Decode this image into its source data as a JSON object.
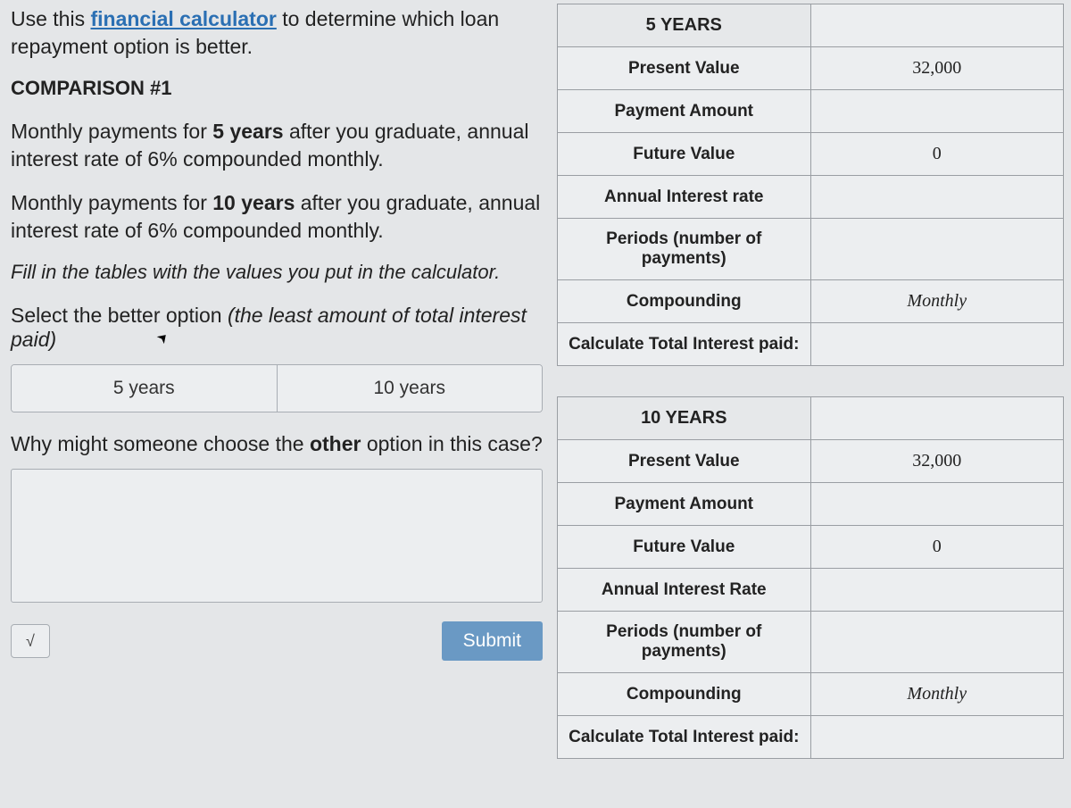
{
  "intro": {
    "prefix": "Use this ",
    "link": "financial calculator",
    "suffix": " to determine which loan repayment option is better."
  },
  "comparison_title": "COMPARISON #1",
  "para1": {
    "p1": "Monthly payments for ",
    "b": "5 years",
    "p2": " after you graduate, annual interest rate of 6% compounded monthly."
  },
  "para2": {
    "p1": "Monthly payments for ",
    "b": "10 years",
    "p2": " after you graduate, annual interest rate of 6% compounded monthly."
  },
  "fill_instruction": "Fill in the tables with the values you put in the calculator.",
  "select_prompt": {
    "a": "Select the better option ",
    "b": "(the least amount of total interest paid)"
  },
  "options": {
    "opt1": "5 years",
    "opt2": "10 years"
  },
  "why_prompt": {
    "a": "Why might someone choose the ",
    "b": "other",
    "c": " option in this case?"
  },
  "math_icon": "√",
  "submit_label": "Submit",
  "table5": {
    "title": "5 YEARS",
    "rows": [
      {
        "label": "Present Value",
        "value": "32,000"
      },
      {
        "label": "Payment Amount",
        "value": ""
      },
      {
        "label": "Future Value",
        "value": "0"
      },
      {
        "label": "Annual Interest rate",
        "value": ""
      },
      {
        "label": "Periods (number of payments)",
        "value": ""
      },
      {
        "label": "Compounding",
        "value": "Monthly",
        "italic": true
      },
      {
        "label": "Calculate Total Interest paid:",
        "value": ""
      }
    ]
  },
  "table10": {
    "title": "10 YEARS",
    "rows": [
      {
        "label": "Present Value",
        "value": "32,000"
      },
      {
        "label": "Payment Amount",
        "value": ""
      },
      {
        "label": "Future Value",
        "value": "0"
      },
      {
        "label": "Annual Interest Rate",
        "value": ""
      },
      {
        "label": "Periods (number of payments)",
        "value": ""
      },
      {
        "label": "Compounding",
        "value": "Monthly",
        "italic": true
      },
      {
        "label": "Calculate Total Interest paid:",
        "value": ""
      }
    ]
  }
}
